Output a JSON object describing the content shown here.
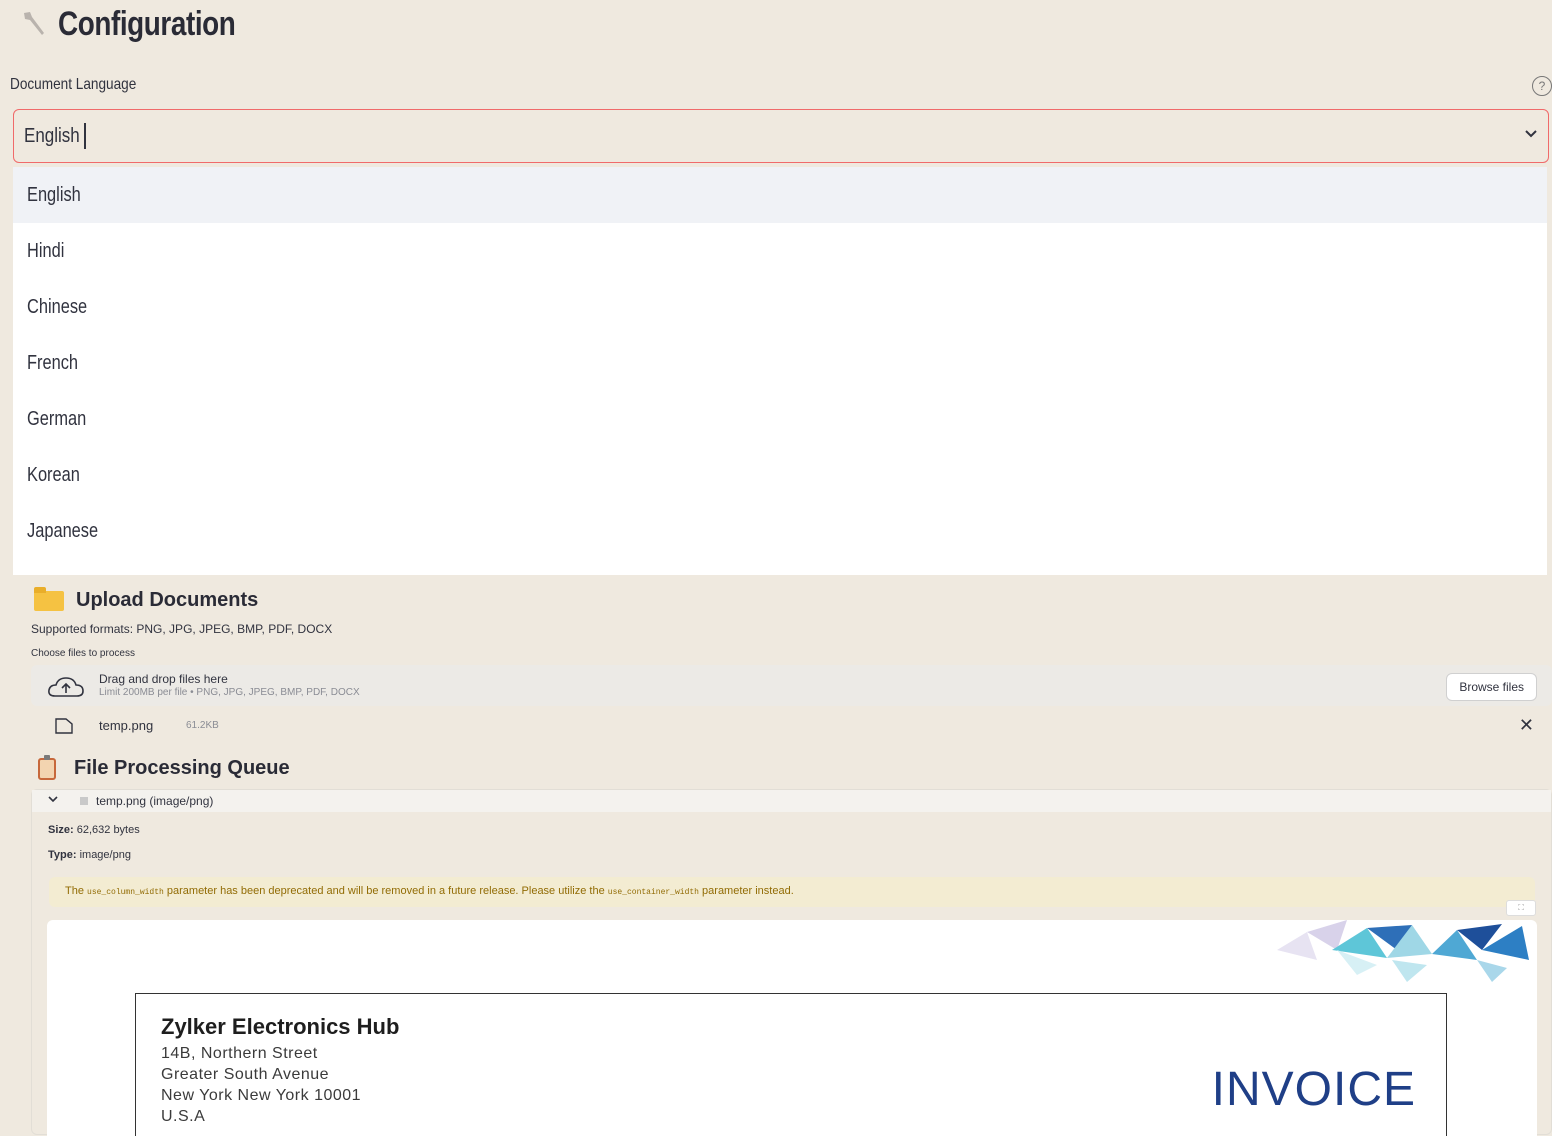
{
  "config": {
    "title": "Configuration",
    "language_label": "Document Language",
    "help": "?",
    "selected_value": "English",
    "chevron": "⌄",
    "options": [
      "English",
      "Hindi",
      "Chinese",
      "French",
      "German",
      "Korean",
      "Japanese"
    ]
  },
  "upload": {
    "title": "Upload Documents",
    "formats": "Supported formats: PNG, JPG, JPEG, BMP, PDF, DOCX",
    "choose_label": "Choose files to process",
    "dropzone_main": "Drag and drop files here",
    "dropzone_sub": "Limit 200MB per file • PNG, JPG, JPEG, BMP, PDF, DOCX",
    "browse_label": "Browse files",
    "file": {
      "name": "temp.png",
      "size": "61.2KB",
      "remove": "✕"
    }
  },
  "queue": {
    "title": "File Processing Queue",
    "expander_label": "temp.png (image/png)",
    "size_key": "Size:",
    "size_value": " 62,632 bytes",
    "type_key": "Type:",
    "type_value": " image/png",
    "warning": {
      "pre": "The ",
      "code1": "use_column_width",
      "mid": " parameter has been deprecated and will be removed in a future release. Please utilize the ",
      "code2": "use_container_width",
      "post": " parameter instead."
    },
    "fullscreen": "⛶"
  },
  "invoice_preview": {
    "company": "Zylker Electronics Hub",
    "address": [
      "14B, Northern Street",
      "Greater South Avenue",
      "New York New York 10001",
      "U.S.A"
    ],
    "heading": "INVOICE"
  },
  "colors": {
    "page_bg": "#efe9df",
    "select_border": "#f06a6a",
    "warning_bg": "#f3ecd2",
    "warning_text": "#926c05",
    "invoice_blue": "#1f3f87"
  },
  "icons": [
    "wrench-icon",
    "help-icon",
    "chevron-down-icon",
    "folder-icon",
    "cloud-upload-icon",
    "file-icon",
    "close-icon",
    "clipboard-icon",
    "fullscreen-icon"
  ]
}
